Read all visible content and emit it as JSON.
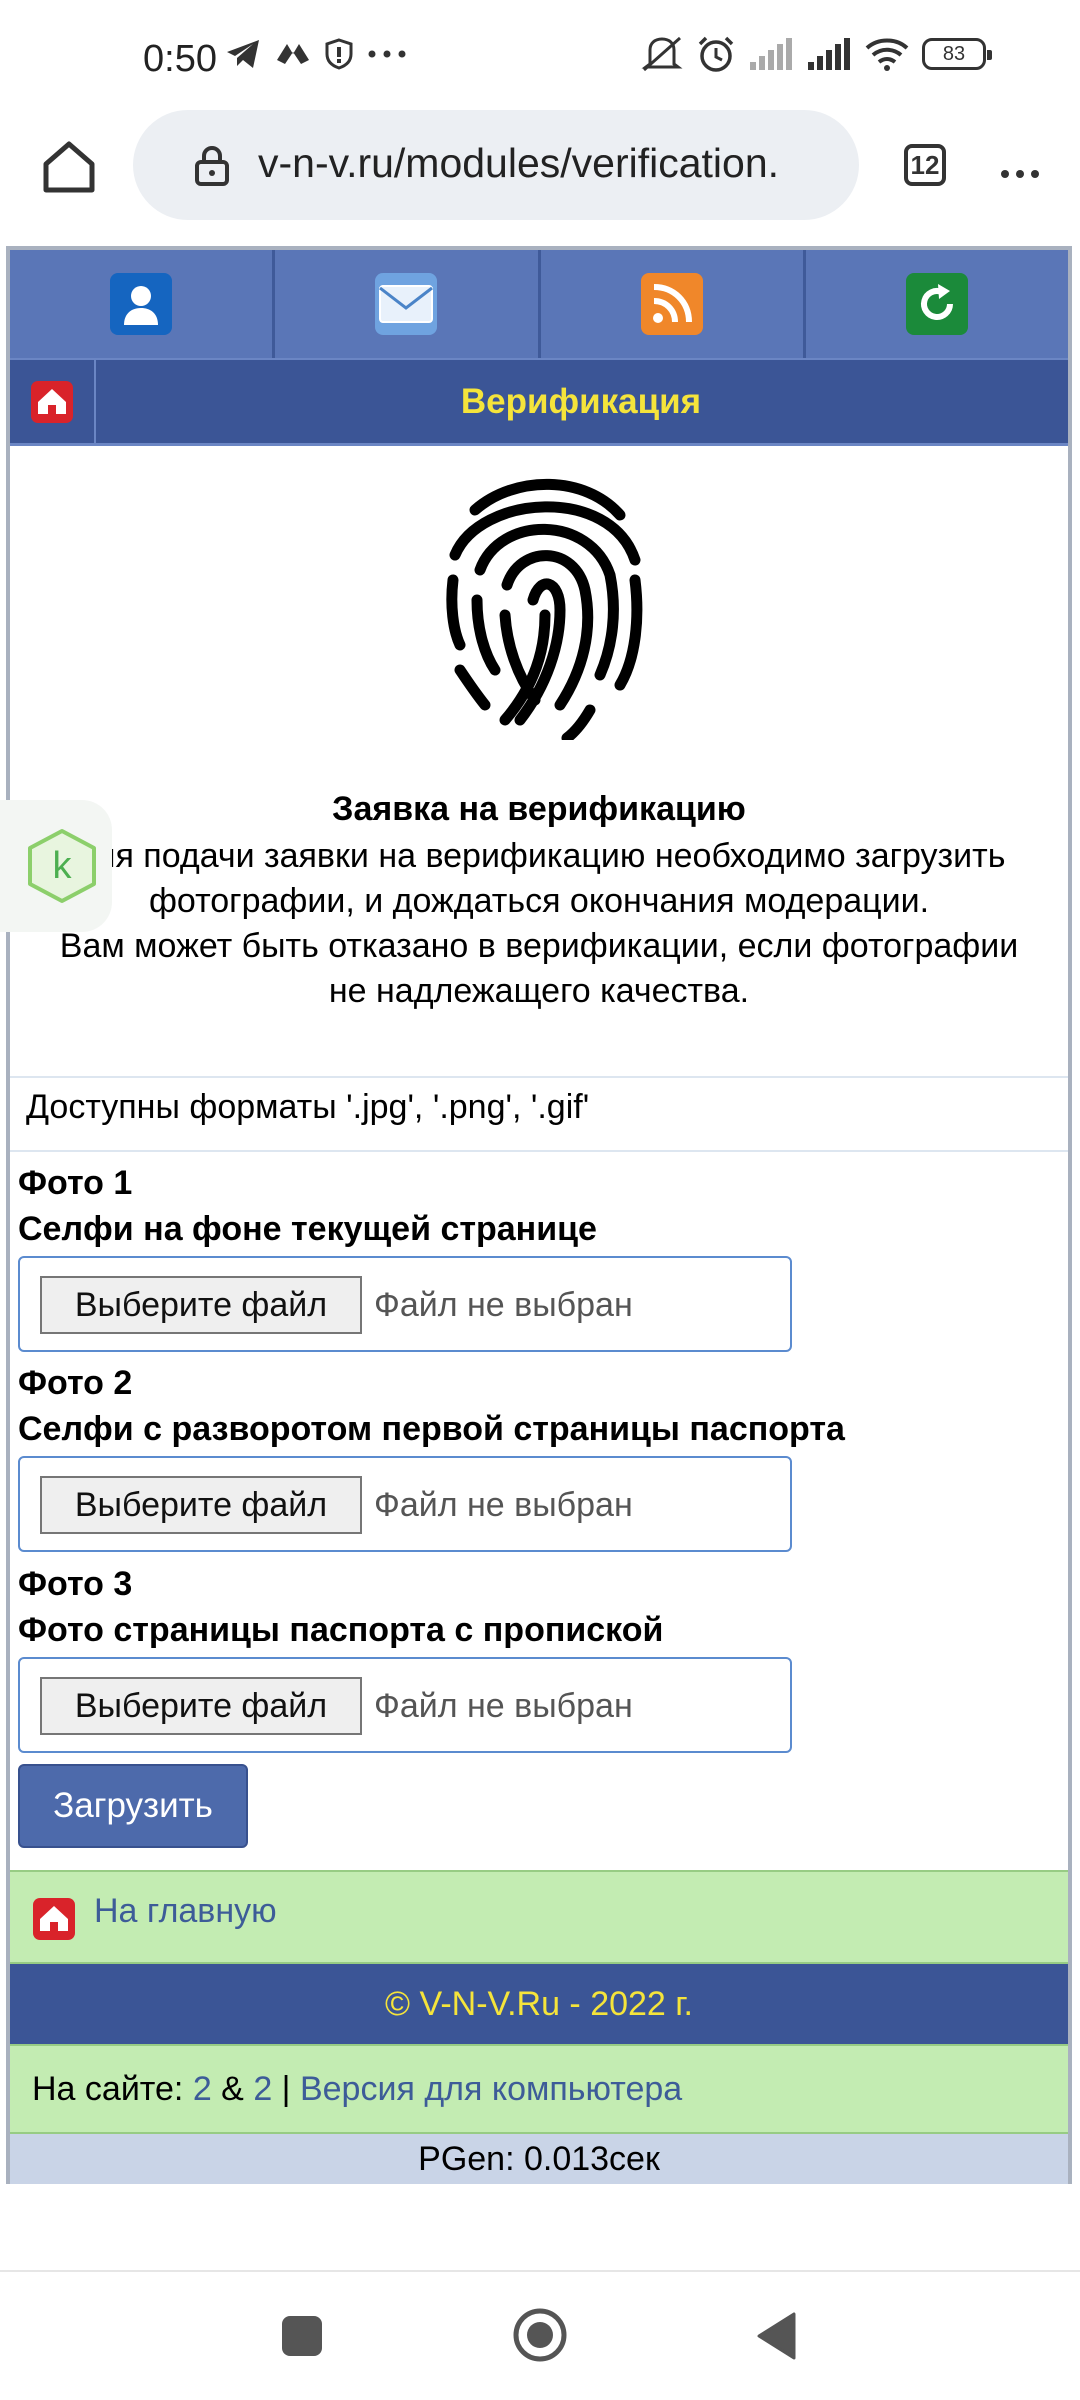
{
  "status_bar": {
    "time": "0:50",
    "battery": "83",
    "icons": [
      "telegram-icon",
      "vpn-icon",
      "shield-icon",
      "more-dots-icon",
      "mute-icon",
      "alarm-icon",
      "signal-icon",
      "signal-icon",
      "wifi-icon",
      "battery-icon"
    ]
  },
  "browser": {
    "url": "v-n-v.ru/modules/verification.",
    "tab_count": "12",
    "menu_glyph": "⋮"
  },
  "site": {
    "top_icons": [
      "user-icon",
      "mail-icon",
      "rss-icon",
      "refresh-icon"
    ],
    "title": "Верификация",
    "request_title": "Заявка на верификацию",
    "request_text_1": "Для подачи заявки на верификацию необходимо загрузить фотографии, и дождаться окончания модерации.",
    "request_text_2": "Вам может быть отказано в верификации, если фотографии не надлежащего качества.",
    "formats": "Доступны форматы '.jpg', '.png', '.gif'",
    "photos": [
      {
        "label": "Фото 1",
        "description": "Селфи на фоне текущей странице",
        "button": "Выберите файл",
        "status": "Файл не выбран"
      },
      {
        "label": "Фото 2",
        "description": "Селфи с разворотом первой страницы паспорта",
        "button": "Выберите файл",
        "status": "Файл не выбран"
      },
      {
        "label": "Фото 3",
        "description": "Фото страницы паспорта с пропиской",
        "button": "Выберите файл",
        "status": "Файл не выбран"
      }
    ],
    "upload_label": "Загрузить",
    "home_link": "На главную",
    "copyright": "© V-N-V.Ru - 2022 г.",
    "online_prefix": "На сайте: ",
    "online_count_1": "2",
    "online_amp": " & ",
    "online_count_2": "2",
    "online_sep": " | ",
    "desktop_link": "Версия для компьютера",
    "pgen": "PGen: 0.013сек"
  },
  "widget": {
    "letter": "k"
  },
  "colors": {
    "header_blue": "#5a76b7",
    "title_bar_blue": "#3b5596",
    "title_yellow": "#f5e43b",
    "green_bar": "#c3ecb2",
    "link_blue": "#3d5c98"
  }
}
